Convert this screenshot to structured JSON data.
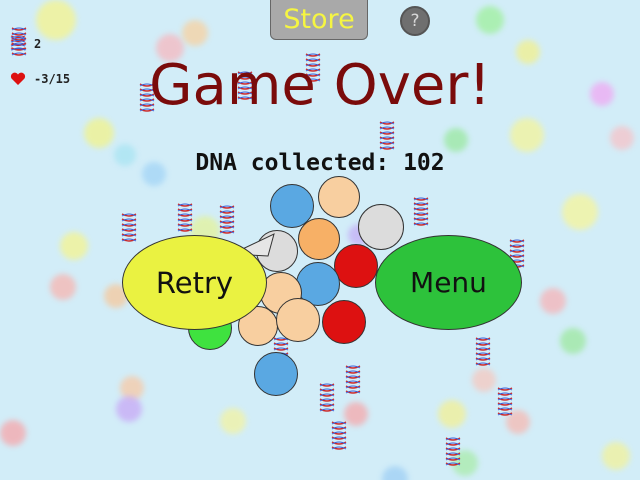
{
  "hud": {
    "level_value": "2",
    "lives_value": "-3/15"
  },
  "header": {
    "store_label": "Store",
    "help_label": "?"
  },
  "dialog": {
    "title": "Game Over!",
    "score_text": "DNA collected: 102",
    "retry_label": "Retry",
    "menu_label": "Menu"
  },
  "colors": {
    "title": "#7a0b0b",
    "retry_button": "#eaf241",
    "menu_button": "#2dc23b",
    "store_text": "#f5f542",
    "background": "#d2edf8",
    "helix": "#cc2a2a"
  },
  "icons": {
    "level": "dna-helix-icon",
    "lives": "heart-icon",
    "help": "question-mark-icon"
  }
}
